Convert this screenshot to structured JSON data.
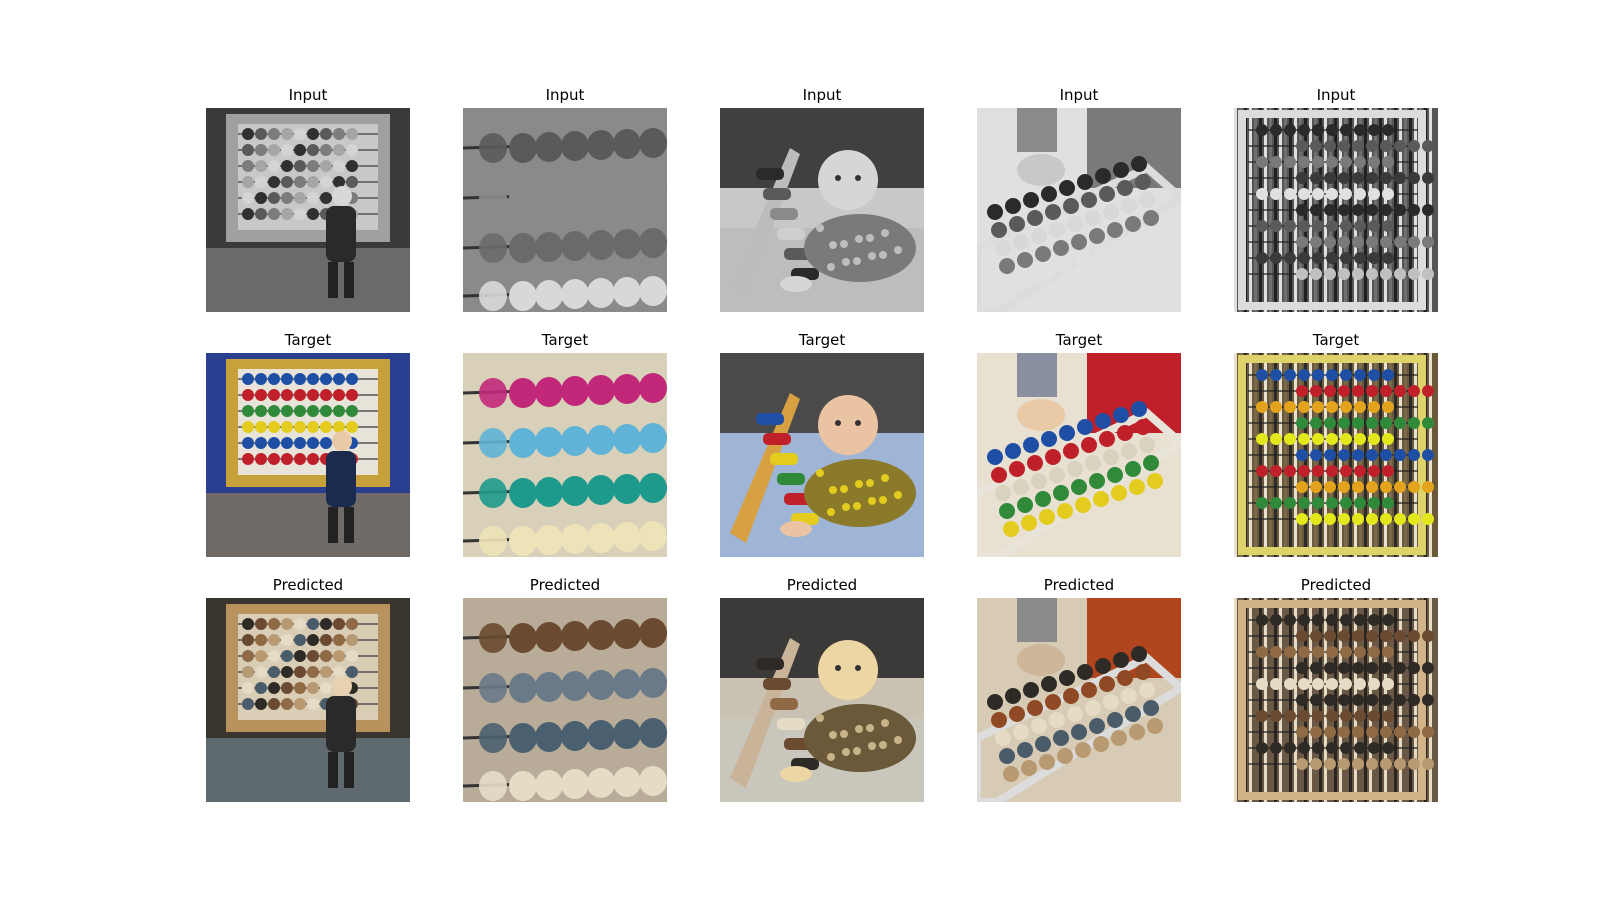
{
  "rows": [
    {
      "label": "Input",
      "mode": "gray"
    },
    {
      "label": "Target",
      "mode": "color"
    },
    {
      "label": "Predicted",
      "mode": "sepia"
    }
  ],
  "columns": [
    {
      "scene": "abacus-playground"
    },
    {
      "scene": "abacus-closeup"
    },
    {
      "scene": "baby-crawling"
    },
    {
      "scene": "hand-on-abacus"
    },
    {
      "scene": "abacus-bookshelf"
    }
  ],
  "palette": {
    "gray": [
      "#303030",
      "#5a5a5a",
      "#7c7c7c",
      "#a5a5a5",
      "#d4d4d4"
    ],
    "color": [
      "#1f4fa5",
      "#c0202a",
      "#2f8a3a",
      "#e3cc1d",
      "#d9d2bf",
      "#c2287a",
      "#5fb3d6",
      "#1e9a8c"
    ],
    "sepia": [
      "#2e2a26",
      "#6a4a30",
      "#8f6a45",
      "#b89a72",
      "#e6dcc6",
      "#4a5c6a"
    ]
  }
}
